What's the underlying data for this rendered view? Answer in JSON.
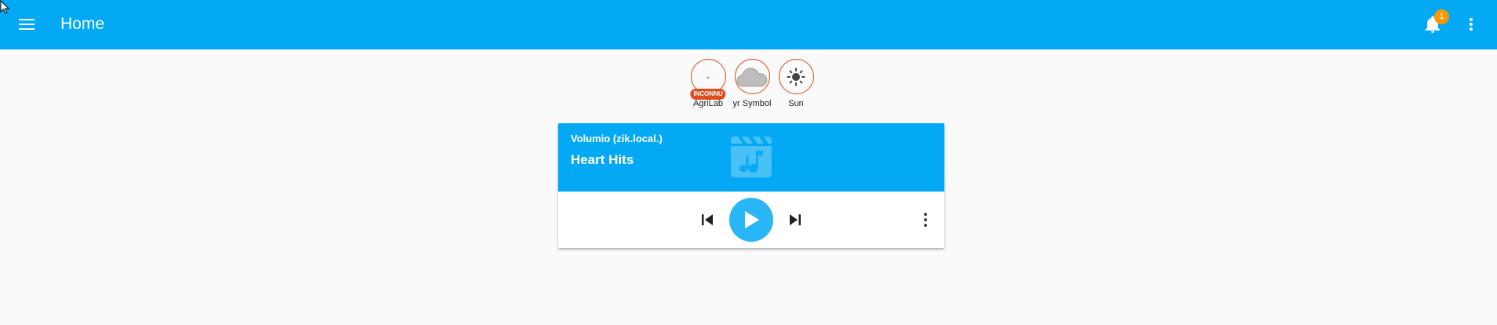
{
  "header": {
    "title": "Home",
    "menu_icon": "menu-icon",
    "notifications": {
      "icon": "bell-icon",
      "count": "1"
    },
    "overflow_icon": "dots-vertical-icon"
  },
  "badges": [
    {
      "name": "AgriLab",
      "value": "-",
      "tag": "INCONNU",
      "icon": null
    },
    {
      "name": "yr Symbol",
      "value": "",
      "icon": "cloud-icon"
    },
    {
      "name": "Sun",
      "value": "",
      "icon": "sun-icon"
    }
  ],
  "media_player": {
    "source": "Volumio (zik.local.)",
    "title": "Heart Hits",
    "art_icon": "movie-music-icon",
    "controls": {
      "previous_icon": "skip-previous-icon",
      "play_icon": "play-icon",
      "next_icon": "skip-next-icon",
      "more_icon": "dots-vertical-icon"
    }
  },
  "colors": {
    "primary": "#03a9f4",
    "accent": "#ff9800",
    "badge_border": "#df4c1e",
    "background": "#fafafa",
    "play_button": "#29b6f6"
  }
}
